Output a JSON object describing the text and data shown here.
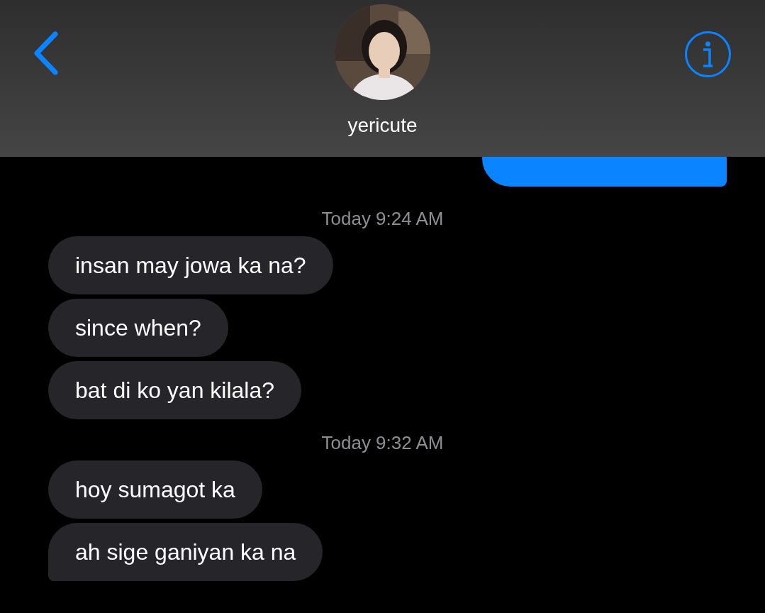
{
  "header": {
    "contact_name": "yericute"
  },
  "messages": [
    {
      "kind": "sent",
      "tail": true
    },
    {
      "kind": "timestamp",
      "text": "Today 9:24 AM"
    },
    {
      "kind": "received",
      "text": "insan may jowa ka na?",
      "tail": false
    },
    {
      "kind": "received",
      "text": "since when?",
      "tail": false
    },
    {
      "kind": "received",
      "text": "bat di ko yan kilala?",
      "tail": false
    },
    {
      "kind": "timestamp",
      "text": "Today 9:32 AM"
    },
    {
      "kind": "received",
      "text": "hoy sumagot ka",
      "tail": false
    },
    {
      "kind": "received",
      "text": "ah sige ganiyan ka na",
      "tail": true
    }
  ]
}
